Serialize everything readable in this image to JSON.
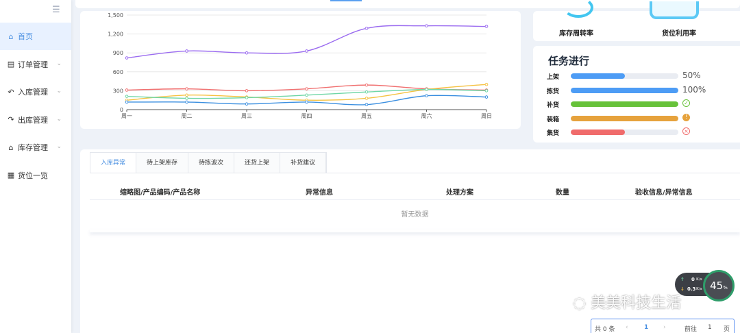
{
  "sidebar": {
    "collapse_icon": "menu-fold-icon",
    "items": [
      {
        "label": "首页",
        "icon": "home-icon",
        "active": true
      },
      {
        "label": "订单管理",
        "icon": "order-icon"
      },
      {
        "label": "入库管理",
        "icon": "inbound-icon"
      },
      {
        "label": "出库管理",
        "icon": "outbound-icon"
      },
      {
        "label": "库存管理",
        "icon": "warehouse-icon"
      },
      {
        "label": "货位一览",
        "icon": "location-icon"
      }
    ]
  },
  "kpis": [
    {
      "label": "库存周转率"
    },
    {
      "label": "货位利用率"
    }
  ],
  "tasks": {
    "title": "任务进行",
    "items": [
      {
        "name": "上架",
        "progress": 0.5,
        "color": "#4d9cf5",
        "value_text": "50%"
      },
      {
        "name": "拣货",
        "progress": 1.0,
        "color": "#4d9cf5",
        "value_text": "100%"
      },
      {
        "name": "补货",
        "progress": 1.0,
        "color": "#67c23a",
        "status": "success"
      },
      {
        "name": "装箱",
        "progress": 1.0,
        "color": "#e6a23c",
        "status": "warning"
      },
      {
        "name": "集货",
        "progress": 0.5,
        "color": "#f06b6b",
        "status": "exception"
      }
    ]
  },
  "chart_data": {
    "type": "line",
    "categories": [
      "周一",
      "周二",
      "周三",
      "周四",
      "周五",
      "周六",
      "周日"
    ],
    "y_ticks": [
      "0",
      "300",
      "600",
      "900",
      "1,200",
      "1,500"
    ],
    "ylim": [
      0,
      1500
    ],
    "series": [
      {
        "color": "#9b6cf0",
        "values": [
          820,
          930,
          900,
          930,
          1290,
          1330,
          1320
        ]
      },
      {
        "color": "#f07070",
        "values": [
          310,
          330,
          300,
          330,
          390,
          330,
          310
        ]
      },
      {
        "color": "#f5c242",
        "values": [
          150,
          230,
          200,
          150,
          180,
          320,
          400
        ]
      },
      {
        "color": "#6fd6a6",
        "values": [
          210,
          180,
          190,
          230,
          280,
          320,
          300
        ]
      },
      {
        "color": "#3b8fe0",
        "values": [
          120,
          120,
          90,
          120,
          80,
          220,
          200
        ]
      }
    ]
  },
  "table": {
    "tabs": [
      "入库异常",
      "待上架库存",
      "待拣波次",
      "还货上架",
      "补货建议"
    ],
    "columns": [
      "缩略图/产品编码/产品名称",
      "异常信息",
      "处理方案",
      "数量",
      "验收信息/异常信息"
    ],
    "empty_text": "暂无数据"
  },
  "pagination": {
    "total": "共 0 条",
    "current": "1",
    "goto_label": "前往",
    "goto_value": "1",
    "page_suffix": "页"
  },
  "watermark": "美美科技生活",
  "speed_widget": {
    "up": "0",
    "up_unit": "K/s",
    "down": "0.3",
    "down_unit": "K/s",
    "percent": "45",
    "percent_unit": "%"
  }
}
